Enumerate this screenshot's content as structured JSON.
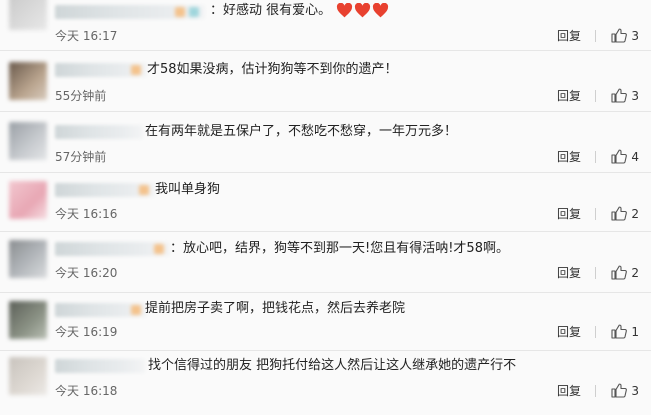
{
  "actions": {
    "reply_label": "回复",
    "like_icon": "thumb-up-icon"
  },
  "hearts": {
    "icon": "red-heart-icon",
    "count": 3,
    "color": "#e8412f"
  },
  "comments": [
    {
      "text": "：好感动 很有爱心。",
      "time": "今天 16:17",
      "likes": "3"
    },
    {
      "text": "才58如果没病，估计狗狗等不到你的遗产！",
      "time": "55分钟前",
      "likes": "3"
    },
    {
      "text": "在有两年就是五保户了，不愁吃不愁穿，一年万元多！",
      "time": "57分钟前",
      "likes": "4"
    },
    {
      "text": "我叫单身狗",
      "time": "今天 16:16",
      "likes": "2"
    },
    {
      "text": "：放心吧，结界，狗等不到那一天!您且有得活呐!才58啊。",
      "time": "今天 16:20",
      "likes": "2"
    },
    {
      "text": "提前把房子卖了啊，把钱花点，然后去养老院",
      "time": "今天 16:19",
      "likes": "1"
    },
    {
      "text": "找个信得过的朋友 把狗托付给这人然后让这人继承她的遗产行不",
      "time": "今天 16:18",
      "likes": "3"
    }
  ]
}
